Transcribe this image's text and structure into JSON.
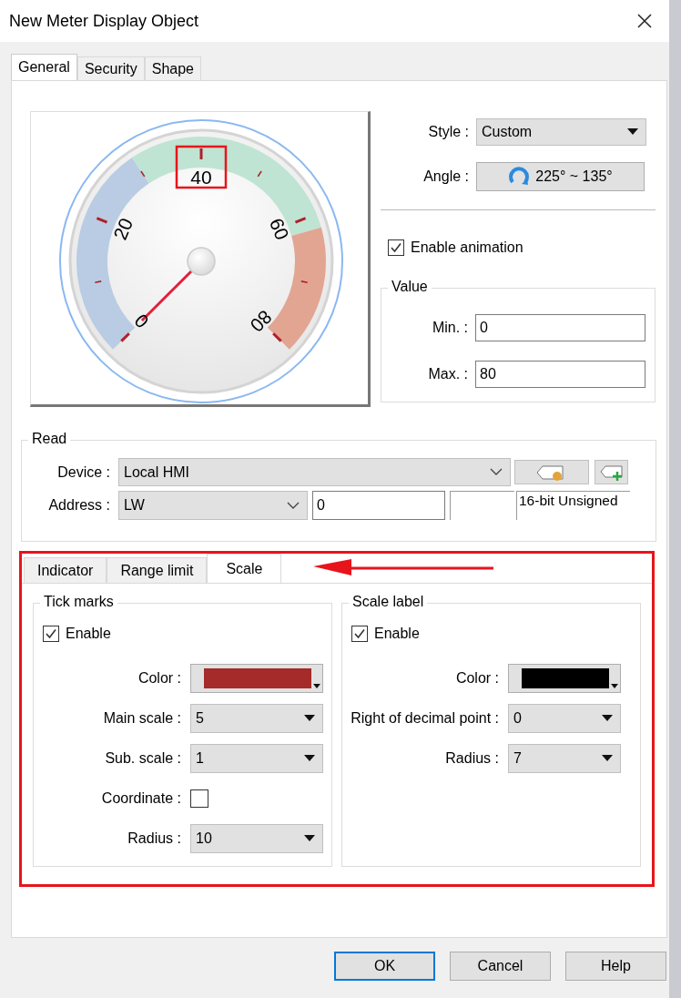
{
  "window": {
    "title": "New Meter Display Object"
  },
  "tabs": [
    {
      "label": "General",
      "selected": true
    },
    {
      "label": "Security",
      "selected": false
    },
    {
      "label": "Shape",
      "selected": false
    }
  ],
  "gauge": {
    "scale_labels": [
      {
        "text": "0",
        "highlighted": false
      },
      {
        "text": "20",
        "highlighted": false
      },
      {
        "text": "40",
        "highlighted": true
      },
      {
        "text": "60",
        "highlighted": false
      },
      {
        "text": "80",
        "highlighted": false
      }
    ]
  },
  "style": {
    "label": "Style :",
    "value": "Custom"
  },
  "angle": {
    "label": "Angle :",
    "value": "225° ~ 135°"
  },
  "enable_animation": {
    "label": "Enable animation",
    "checked": true
  },
  "value_group": {
    "title": "Value",
    "min": {
      "label": "Min. :",
      "value": "0"
    },
    "max": {
      "label": "Max. :",
      "value": "80"
    }
  },
  "read": {
    "title": "Read",
    "device": {
      "label": "Device :",
      "value": "Local HMI"
    },
    "address": {
      "label": "Address :",
      "type": "LW",
      "value": "0",
      "data_type": "16-bit Unsigned"
    }
  },
  "sub_tabs": [
    {
      "label": "Indicator",
      "selected": false
    },
    {
      "label": "Range limit",
      "selected": false
    },
    {
      "label": "Scale",
      "selected": true
    }
  ],
  "tick_marks": {
    "title": "Tick marks",
    "enable": {
      "label": "Enable",
      "checked": true
    },
    "fields": [
      {
        "kind": "color",
        "label": "Color :",
        "color": "#a52a2a"
      },
      {
        "kind": "select",
        "label": "Main scale :",
        "value": "5"
      },
      {
        "kind": "select",
        "label": "Sub. scale :",
        "value": "1"
      },
      {
        "kind": "checkbox",
        "label": "Coordinate :",
        "checked": false
      },
      {
        "kind": "select",
        "label": "Radius :",
        "value": "10"
      }
    ]
  },
  "scale_label": {
    "title": "Scale label",
    "enable": {
      "label": "Enable",
      "checked": true
    },
    "fields": [
      {
        "kind": "color",
        "label": "Color :",
        "color": "#000000"
      },
      {
        "kind": "select",
        "label": "Right of decimal point :",
        "value": "0"
      },
      {
        "kind": "select",
        "label": "Radius :",
        "value": "7"
      }
    ]
  },
  "buttons": [
    {
      "label": "OK",
      "default": true
    },
    {
      "label": "Cancel",
      "default": false
    },
    {
      "label": "Help",
      "default": false
    }
  ]
}
